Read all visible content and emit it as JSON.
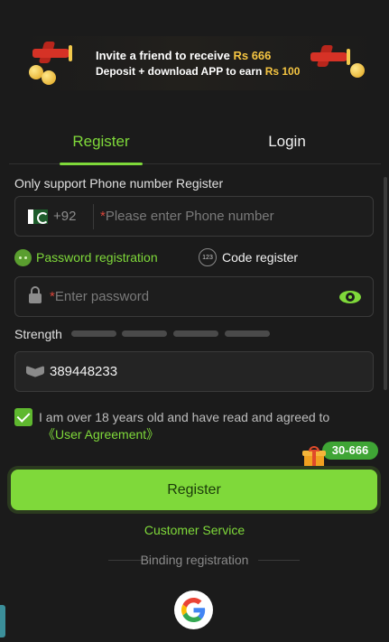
{
  "banner": {
    "line1_prefix": "Invite a friend to receive",
    "line1_amount": "Rs 666",
    "line2_prefix": "Deposit + download APP to earn",
    "line2_amount": "Rs 100"
  },
  "tabs": [
    {
      "label": "Register",
      "active": true
    },
    {
      "label": "Login",
      "active": false
    }
  ],
  "form": {
    "support_hint": "Only support Phone number Register",
    "phone": {
      "country_code": "+92",
      "required_mark": "*",
      "placeholder": "Please enter Phone number"
    },
    "modes": {
      "password_label": "Password registration",
      "code_label": "Code register",
      "code_icon_text": "123"
    },
    "password": {
      "required_mark": "*",
      "placeholder": "Enter password"
    },
    "strength_label": "Strength",
    "invite_code": "389448233",
    "agreement": {
      "checked": true,
      "text": "I am over 18 years old and have read and agreed to",
      "link": "《User Agreement》"
    },
    "promo_badge": "30-666",
    "register_button": "Register"
  },
  "customer_service": "Customer Service",
  "binding_label": "Binding registration",
  "colors": {
    "accent": "#7fd93a",
    "background": "#1b1b1b",
    "field_border": "#3a3a3a",
    "required": "#d8453a"
  }
}
